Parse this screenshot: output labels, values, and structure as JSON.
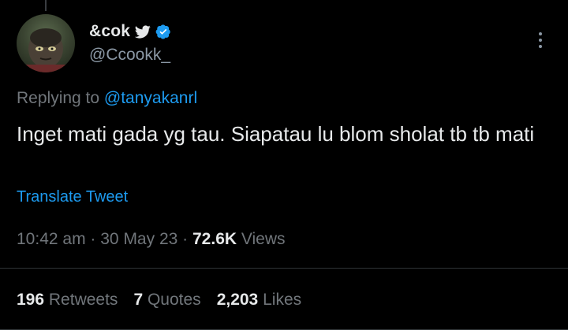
{
  "colors": {
    "background": "#000000",
    "text_primary": "#e7e9ea",
    "text_secondary": "#71767b",
    "accent": "#1d9bf0"
  },
  "author": {
    "display_name": "&cok",
    "handle": "@Ccookk_",
    "verified_icon": "verified-badge-icon",
    "brand_icon": "twitter-bird-icon"
  },
  "reply": {
    "prefix": "Replying to",
    "mention": "@tanyakanrl"
  },
  "tweet": {
    "text": "Inget mati gada yg tau. Siapatau lu blom sholat tb tb mati",
    "translate_label": "Translate Tweet"
  },
  "meta": {
    "time": "10:42 am",
    "separator": "·",
    "date": "30 May 23",
    "views_count": "72.6K",
    "views_label": "Views"
  },
  "stats": {
    "retweets_count": "196",
    "retweets_label": "Retweets",
    "quotes_count": "7",
    "quotes_label": "Quotes",
    "likes_count": "2,203",
    "likes_label": "Likes"
  },
  "icons": {
    "more": "more-options-icon"
  }
}
